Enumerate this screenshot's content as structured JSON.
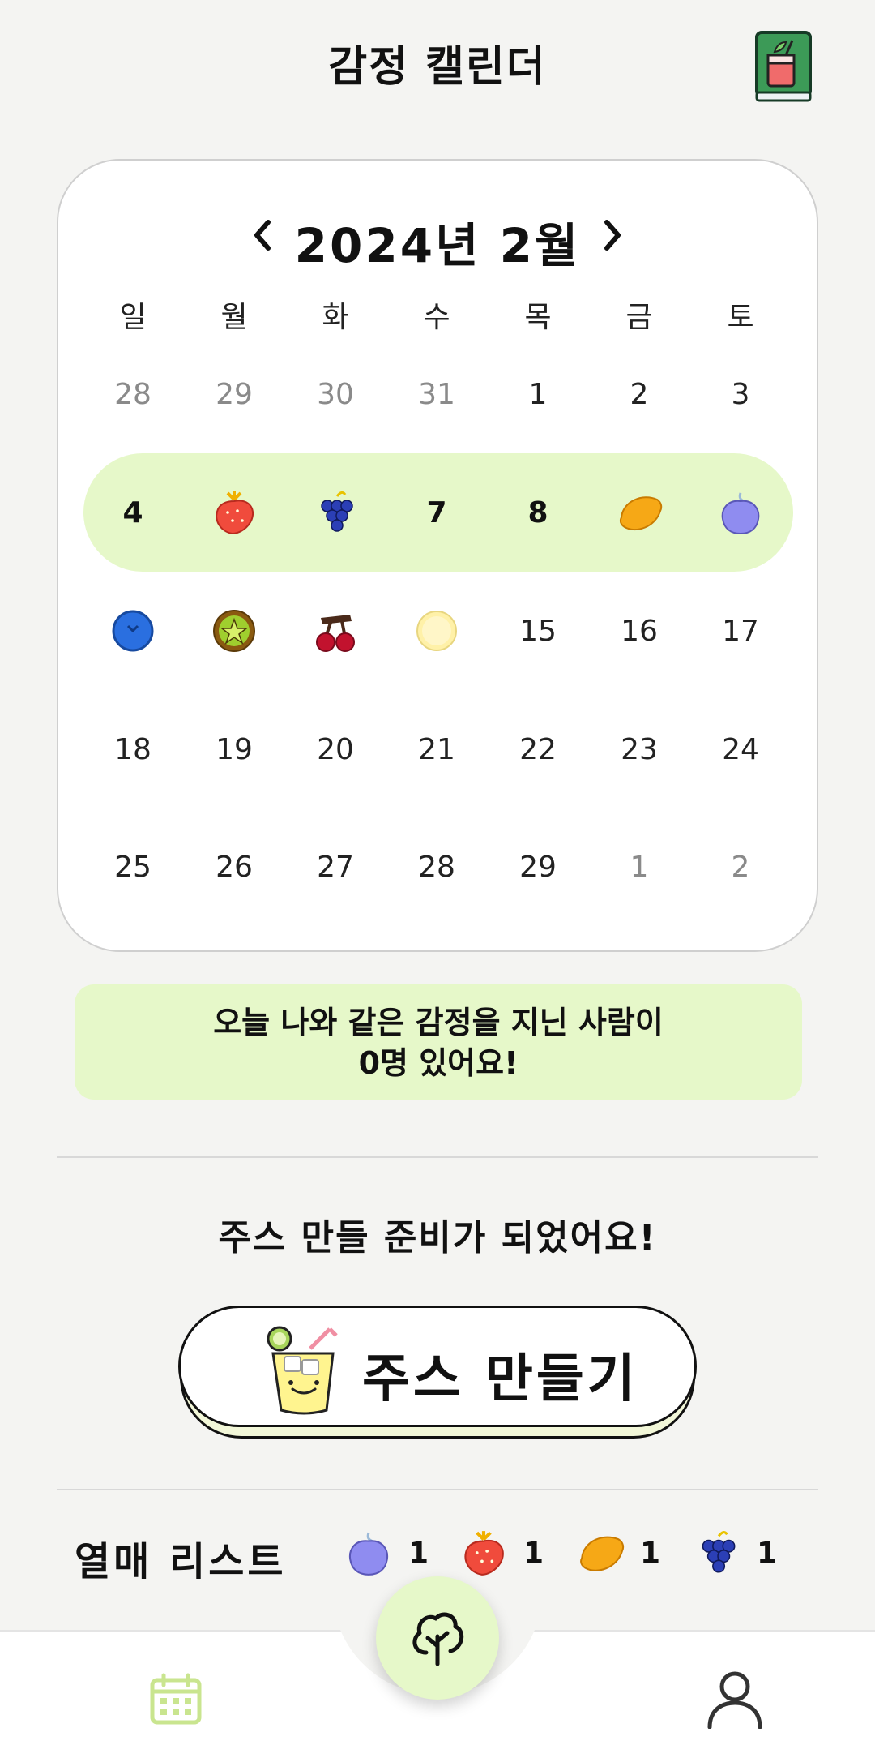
{
  "header": {
    "title": "감정 캘린더",
    "recipe_book_icon": "juice-recipe-book-icon"
  },
  "calendar": {
    "month_label": "2024년  2월",
    "prev_icon": "chevron-left-icon",
    "next_icon": "chevron-right-icon",
    "weekdays": [
      "일",
      "월",
      "화",
      "수",
      "목",
      "금",
      "토"
    ],
    "weeks": [
      [
        {
          "t": "28",
          "m": true
        },
        {
          "t": "29",
          "m": true
        },
        {
          "t": "30",
          "m": true
        },
        {
          "t": "31",
          "m": true
        },
        {
          "t": "1"
        },
        {
          "t": "2"
        },
        {
          "t": "3"
        }
      ],
      [
        {
          "t": "4",
          "b": true
        },
        {
          "f": "strawberry"
        },
        {
          "f": "grape"
        },
        {
          "t": "7",
          "b": true
        },
        {
          "t": "8",
          "b": true
        },
        {
          "f": "lemon"
        },
        {
          "f": "plum"
        }
      ],
      [
        {
          "f": "blueberry"
        },
        {
          "f": "kiwi"
        },
        {
          "f": "cherry"
        },
        {
          "f": "pear"
        },
        {
          "t": "15"
        },
        {
          "t": "16"
        },
        {
          "t": "17"
        }
      ],
      [
        {
          "t": "18"
        },
        {
          "t": "19"
        },
        {
          "t": "20"
        },
        {
          "t": "21"
        },
        {
          "t": "22"
        },
        {
          "t": "23"
        },
        {
          "t": "24"
        }
      ],
      [
        {
          "t": "25"
        },
        {
          "t": "26"
        },
        {
          "t": "27"
        },
        {
          "t": "28"
        },
        {
          "t": "29"
        },
        {
          "t": "1",
          "m": true
        },
        {
          "t": "2",
          "m": true
        }
      ]
    ],
    "highlight_color": "#e6f8c9"
  },
  "emotion_share": {
    "line1": "오늘 나와 같은 감정을 지닌 사람이",
    "line2": "0명 있어요!"
  },
  "juice": {
    "ready_text": "주스 만들 준비가 되었어요!",
    "button_label": "주스 만들기",
    "button_icon": "lemonade-cup-icon"
  },
  "fruit_list": {
    "title": "열매 리스트",
    "items": [
      {
        "fruit": "plum",
        "count": "1"
      },
      {
        "fruit": "strawberry",
        "count": "1"
      },
      {
        "fruit": "lemon",
        "count": "1"
      },
      {
        "fruit": "grape",
        "count": "1"
      }
    ]
  },
  "bottom_nav": {
    "left_icon": "calendar-icon",
    "center_icon": "tree-icon",
    "right_icon": "profile-icon"
  },
  "colors": {
    "accent_green": "#e6f8c9",
    "calendar_icon_green": "#c9e58f"
  }
}
